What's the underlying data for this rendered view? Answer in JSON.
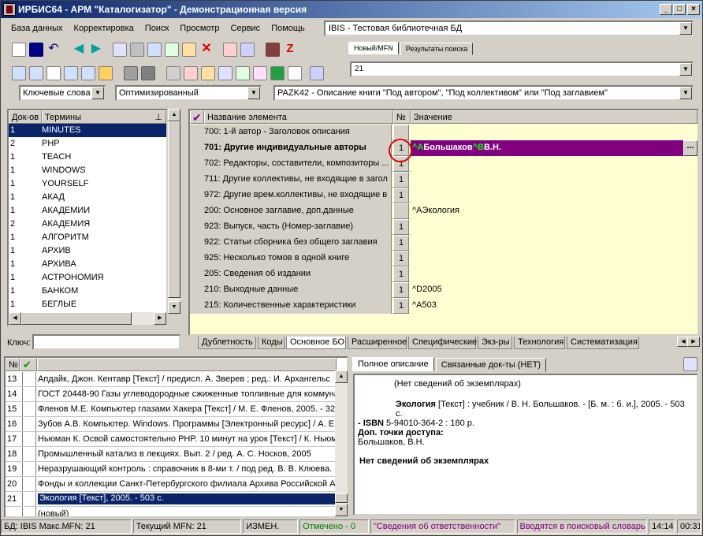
{
  "window": {
    "title": "ИРБИС64 - АРМ \"Каталогизатор\" - Демонстрационная версия",
    "min": "_",
    "max": "□",
    "close": "×"
  },
  "menu": [
    "База данных",
    "Корректировка",
    "Поиск",
    "Просмотр",
    "Сервис",
    "Помощь"
  ],
  "database": {
    "selected": "IBIS - Тестовая библиотечная БД"
  },
  "mfn_tabs": [
    "Новый/MFN",
    "Результаты поиска"
  ],
  "mfn_value": "21",
  "search_mode": {
    "type": "Ключевые слова",
    "mode": "Оптимизированный",
    "worksheet": "PAZK42 - Описание книги \"Под автором\", \"Под коллективом\" или \"Под заглавием\""
  },
  "terms": {
    "col_count": "Док-ов",
    "col_term": "Термины",
    "rows": [
      {
        "n": "1",
        "t": "MINUTES"
      },
      {
        "n": "2",
        "t": "PHP"
      },
      {
        "n": "1",
        "t": "TEACH"
      },
      {
        "n": "1",
        "t": "WINDOWS"
      },
      {
        "n": "1",
        "t": "YOURSELF"
      },
      {
        "n": "1",
        "t": "АКАД"
      },
      {
        "n": "1",
        "t": "АКАДЕМИИ"
      },
      {
        "n": "2",
        "t": "АКАДЕМИЯ"
      },
      {
        "n": "1",
        "t": "АЛГОРИТМ"
      },
      {
        "n": "1",
        "t": "АРХИВ"
      },
      {
        "n": "1",
        "t": "АРХИВА"
      },
      {
        "n": "1",
        "t": "АСТРОНОМИЯ"
      },
      {
        "n": "1",
        "t": "БАНКОМ"
      },
      {
        "n": "1",
        "t": "БЕГЛЫЕ"
      }
    ],
    "key_label": "Ключ:"
  },
  "fields": {
    "col_name": "Название элемента",
    "col_no": "№",
    "col_value": "Значение",
    "rows": [
      {
        "name": "700: 1-й автор - Заголовок описания",
        "no": "",
        "value": ""
      },
      {
        "name": "701: Другие индивидуальные авторы",
        "no": "1",
        "value": "^AБольшаков^BВ.Н."
      },
      {
        "name": "702: Редакторы, составители, композиторы ...",
        "no": "1",
        "value": ""
      },
      {
        "name": "711: Другие коллективы, не входящие в загол",
        "no": "1",
        "value": ""
      },
      {
        "name": "972: Другие врем.коллективы, не входящие в",
        "no": "1",
        "value": ""
      },
      {
        "name": "200: Основное заглавие, доп.данные",
        "no": "",
        "value": "^AЭкология"
      },
      {
        "name": "923: Выпуск, часть (Номер-заглавие)",
        "no": "1",
        "value": ""
      },
      {
        "name": "922: Статьи сборника без общего заглавия",
        "no": "1",
        "value": ""
      },
      {
        "name": "925: Несколько томов в одной книге",
        "no": "1",
        "value": ""
      },
      {
        "name": "205: Сведения об издании",
        "no": "1",
        "value": ""
      },
      {
        "name": "210: Выходные данные",
        "no": "1",
        "value": "^D2005"
      },
      {
        "name": "215: Количественные характеристики",
        "no": "1",
        "value": "^A503"
      }
    ],
    "selected_value": {
      "a": "^A",
      "b": "Большаков",
      "c": "^B",
      "d": "В.Н."
    },
    "dots": "..."
  },
  "ws_tabs": [
    "Дублетность",
    "Коды",
    "Основное БО",
    "Расширенное",
    "Специфические",
    "Экз-ры",
    "Технология",
    "Систематизация"
  ],
  "results": {
    "rows": [
      {
        "n": "13",
        "t": "Апдайк, Джон. Кентавр [Текст] / предисл. А. Зверев ; ред.: И. Архангельс"
      },
      {
        "n": "14",
        "t": "ГОСТ 20448-90 Газы углеводородные сжиженные топливные для коммуна"
      },
      {
        "n": "15",
        "t": "Фленов М.Е. Компьютер глазами Хакера [Текст] / М. Е. Фленов, 2005. - 323"
      },
      {
        "n": "16",
        "t": "Зубов А.В. Компьютер. Windows. Программы [Электронный ресурс] / А. Е"
      },
      {
        "n": "17",
        "t": "Ньюман К. Освой самостоятельно PHP. 10 минут на урок [Текст] / К. Ньюм"
      },
      {
        "n": "18",
        "t": "Промышленный катализ в лекциях. Вып. 2 / ред. А. С. Носков, 2005"
      },
      {
        "n": "19",
        "t": "Неразрушающий контроль : справочник в 8-ми т. / под ред. В. В. Клюева. "
      },
      {
        "n": "20",
        "t": "Фонды и коллекции Санкт-Петербургского филиала Архива Российской Ак"
      },
      {
        "n": "21",
        "t": "Экология [Текст], 2005. - 503 с."
      },
      {
        "n": "",
        "t": "(новый)"
      }
    ],
    "col_n": "№"
  },
  "desc_tabs": [
    "Полное описание",
    "Связанные док-ты (НЕТ)"
  ],
  "desc": {
    "line1": "(Нет сведений об экземплярах)",
    "title": "Экология",
    "rest": " [Текст] : учебник / В. Н. Большаков. - [Б. м. : б. и.], 2005. - 503 с.",
    "isbn_label": "- ISBN",
    "isbn": " 5-94010-364-2 : 180 р.",
    "access": "Доп. точки доступа:",
    "author": "Большаков, В.Н.",
    "noex": "Нет сведений об экземплярах"
  },
  "status": {
    "db": "БД: IBIS Макс.MFN: 21",
    "cur": "Текущий MFN: 21",
    "changed": "ИЗМЕН.",
    "marked": "Отмечено - 0",
    "field": "\"Сведения об ответственности\"",
    "dict": "Вводятся в поисковый словарь",
    "time": "14:14",
    "clock2": "00:31"
  },
  "colors": {
    "select": "#0a246a",
    "purple": "#800080",
    "yellow": "#fffed0"
  }
}
